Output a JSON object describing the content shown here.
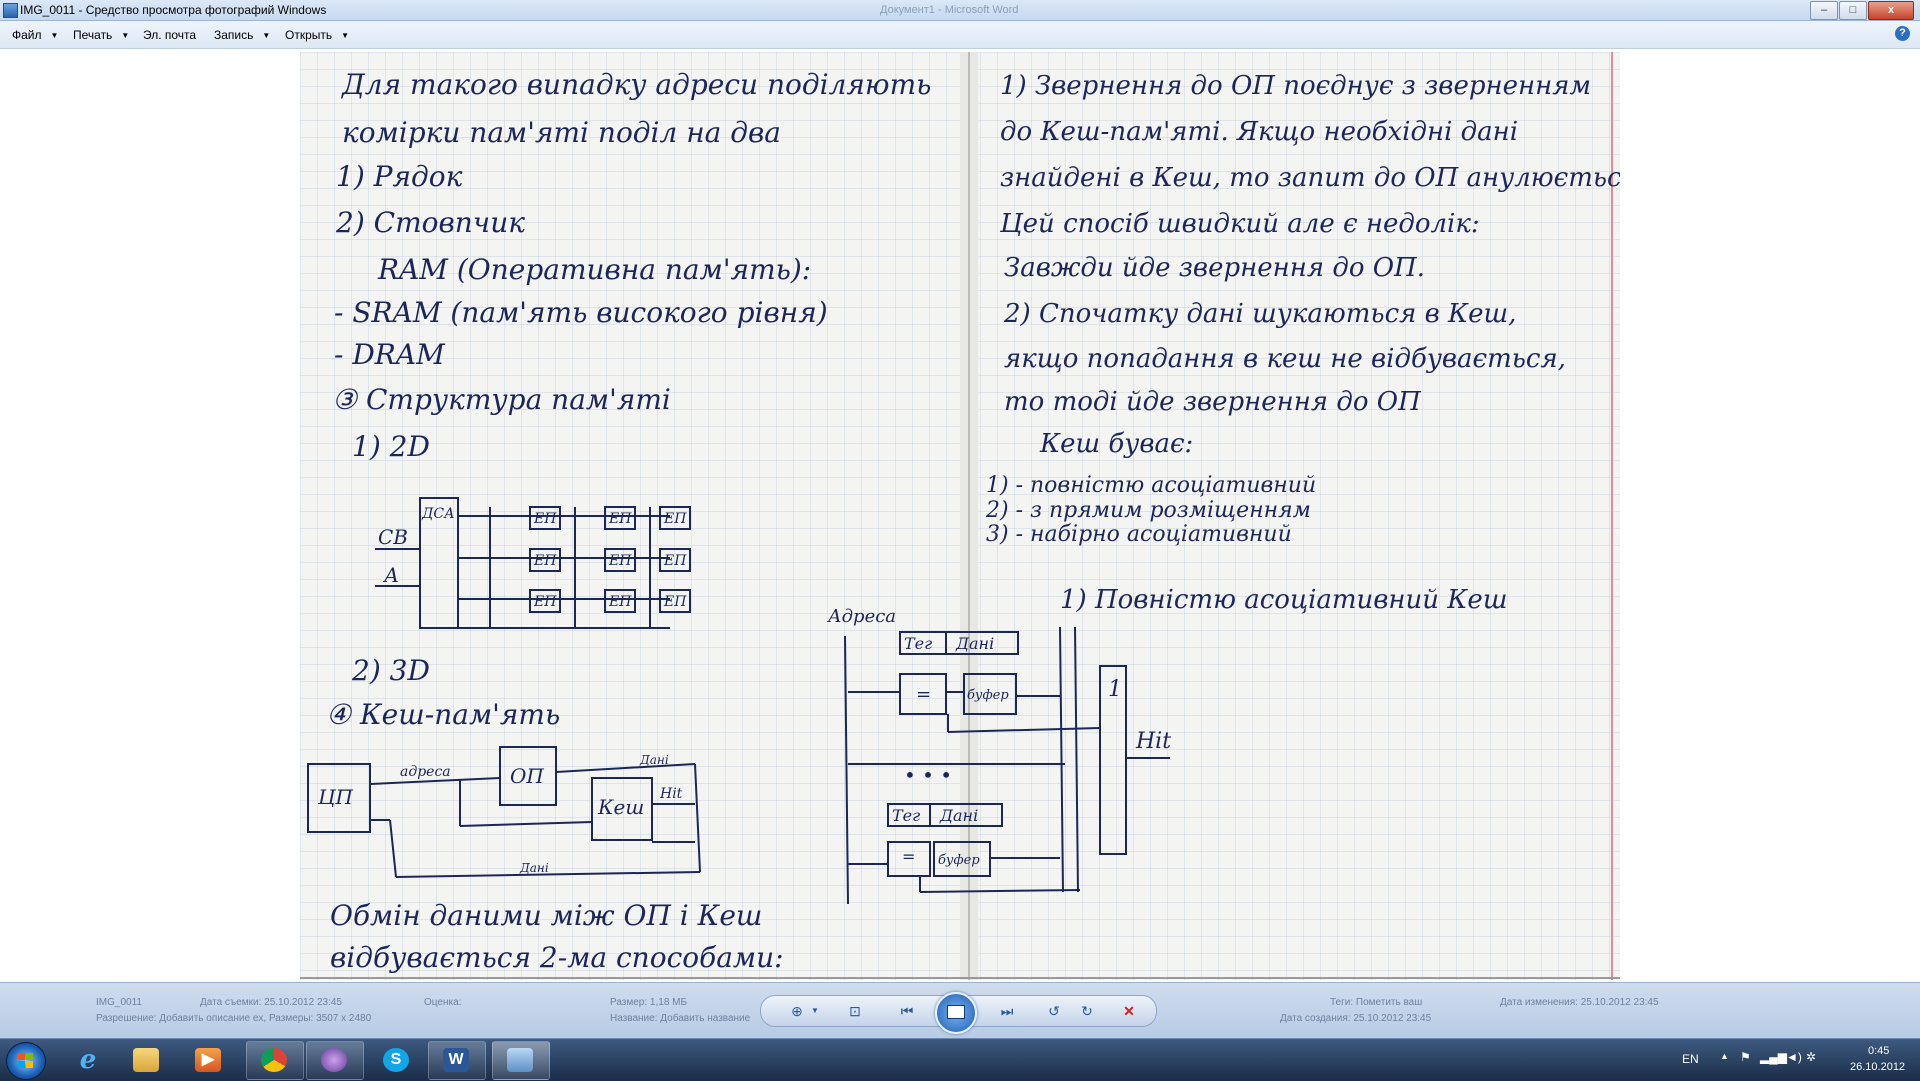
{
  "window": {
    "title": "IMG_0011 - Средство просмотра фотографий Windows",
    "ghost_title": "Документ1 - Microsoft Word",
    "minimize": "–",
    "maximize": "□",
    "close": "x"
  },
  "menu": {
    "items": [
      {
        "label": "Файл",
        "has_arrow": true
      },
      {
        "label": "Печать",
        "has_arrow": true
      },
      {
        "label": "Эл. почта",
        "has_arrow": false
      },
      {
        "label": "Запись",
        "has_arrow": true
      },
      {
        "label": "Открыть",
        "has_arrow": true
      }
    ],
    "help": "?"
  },
  "infobar": {
    "name": "IMG_0011",
    "taken": "Дата съемки: 25.10.2012 23:45",
    "rating": "Оценка:",
    "size_label": "Размер: 1,18 МБ",
    "title_label": "Название: Добавить название",
    "tags_label": "Теги: Пометить ваш",
    "modified": "Дата изменения: 25.10.2012 23:45",
    "dimensions": "Разрешение: Добавить описание ex, Размеры: 3507 x 2480",
    "created": "Дата создания: 25.10.2012 23:45"
  },
  "controls": {
    "zoom": "zoom-icon",
    "fit": "fit-icon",
    "prev": "previous-icon",
    "slideshow": "slideshow-icon",
    "next": "next-icon",
    "rotate_ccw": "rotate-left-icon",
    "rotate_cw": "rotate-right-icon",
    "delete": "delete-icon"
  },
  "taskbar": {
    "apps": [
      "internet-explorer-icon",
      "file-explorer-icon",
      "media-player-icon",
      "chrome-icon",
      "bittorrent-icon",
      "skype-icon",
      "word-icon",
      "photo-viewer-icon"
    ],
    "language": "EN",
    "time": "0:45",
    "date": "26.10.2012"
  },
  "notes": {
    "left_page": [
      "Для такого випадку адреси поділяють",
      "комірки пам'яті поділ на два",
      "1) Рядок",
      "2) Стовпчик",
      "RAM (Оперативна пам'ять):",
      "- SRAM (пам'ять високого рівня)",
      "- DRAM",
      "③ Структура пам'яті",
      "1) 2D",
      "2) 3D",
      "④ Кеш-пам'ять",
      "Обмін даними між ОП і Кеш",
      "відбувається 2-ма способами:"
    ],
    "left_diagram_2d": {
      "decoder": "ДСА",
      "inputs": [
        "СВ",
        "А"
      ],
      "cell": "ЕП"
    },
    "left_diagram_cache": {
      "cpu": "ЦП",
      "ram": "ОП",
      "cache": "Кеш",
      "address": "адреса",
      "data_top": "Дані",
      "data_bottom": "Дані",
      "hit": "Hit"
    },
    "right_page": [
      "1) Звернення до ОП поєднує з зверненням",
      "до Кеш-пам'яті. Якщо необхідні дані",
      "знайдені в Кеш, то запит до ОП анулюється",
      "Цей спосіб швидкий але є недолік:",
      "Завжди йде звернення до ОП.",
      "2) Спочатку дані шукаються в Кеш,",
      "якщо попадання в кеш не відбувається,",
      "то тоді йде звернення до ОП",
      "Кеш буває:",
      "1) - повністю асоціативний",
      "2) - з прямим розміщенням",
      "3) - набірно асоціативний",
      "1) Повністю асоціативний Кеш"
    ],
    "right_diagram": {
      "address": "Адреса",
      "tag": "Тег",
      "data": "Дані",
      "compare": "=",
      "buffer": "буфер",
      "or_gate": "1",
      "hit": "Hit",
      "dots": "• • •"
    }
  }
}
